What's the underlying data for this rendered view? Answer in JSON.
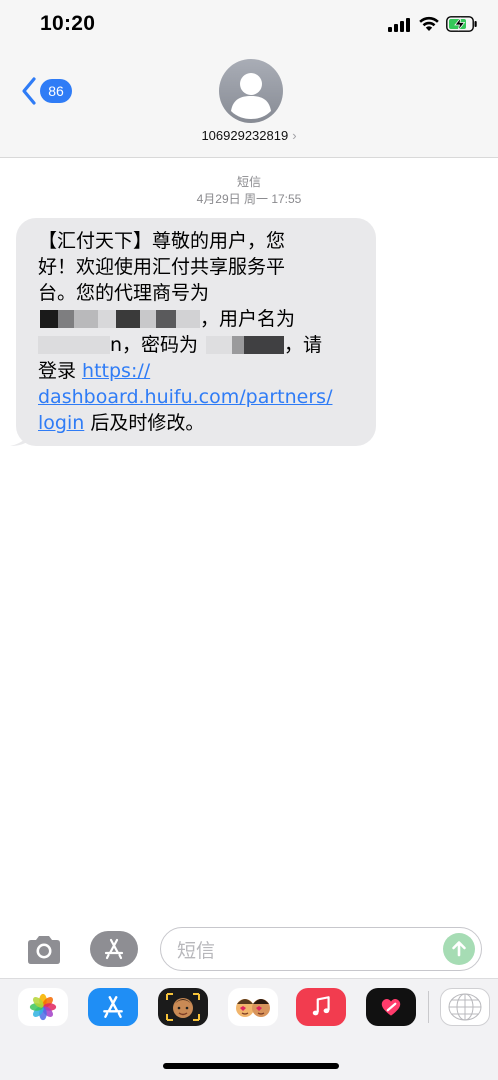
{
  "status_bar": {
    "time": "10:20"
  },
  "header": {
    "back_badge": "86",
    "contact": "106929232819",
    "contact_chevron": "›"
  },
  "conversation": {
    "service": "短信",
    "timestamp": "4月29日 周一 17:55",
    "message": {
      "line1": "【汇付天下】尊敬的用户，您",
      "line2": "好！欢迎使用汇付共享服务平",
      "line3": "台。您的代理商号为",
      "line4_tail": "，用户名为",
      "line5_a": "n，密码为",
      "line5_b": "，请",
      "line6_prefix": "登录 ",
      "link_part1": "https://",
      "link_part2": "dashboard.huifu.com/partners/",
      "link_part3": "login",
      "suffix": " 后及时修改。"
    }
  },
  "input": {
    "placeholder": "短信"
  },
  "icons": {
    "camera": "camera-icon",
    "apps": "app-store-icon",
    "send": "send-arrow-icon"
  },
  "colors": {
    "accent": "#2f7cf6",
    "bubble": "#e9e9eb",
    "send": "#a6dcb4"
  }
}
